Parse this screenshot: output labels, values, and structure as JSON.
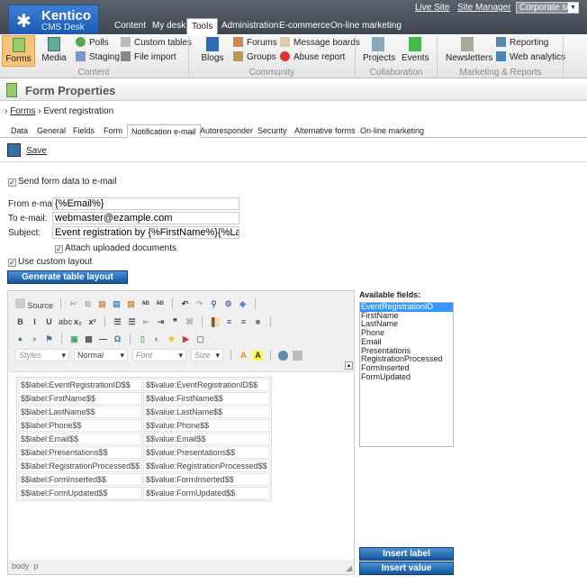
{
  "header": {
    "logo_title": "Kentico",
    "logo_sub": "CMS Desk",
    "links": [
      "Live Site",
      "Site Manager"
    ],
    "site_select": "Corporate site",
    "tabs": [
      "Content",
      "My desk",
      "Tools",
      "Administration",
      "E-commerce",
      "On-line marketing"
    ],
    "active_tab": "Tools"
  },
  "ribbon": {
    "groups": [
      "Content",
      "Community",
      "Collaboration",
      "Marketing & Reports"
    ],
    "items": {
      "forms": "Forms",
      "media": "Media",
      "polls": "Polls",
      "staging": "Staging",
      "custom_tables": "Custom tables",
      "file_import": "File import",
      "blogs": "Blogs",
      "forums": "Forums",
      "groups": "Groups",
      "message_boards": "Message boards",
      "abuse_report": "Abuse report",
      "projects": "Projects",
      "events": "Events",
      "newsletters": "Newsletters",
      "reporting": "Reporting",
      "web_analytics": "Web analytics"
    }
  },
  "page": {
    "title": "Form Properties",
    "breadcrumb": [
      "Forms",
      "Event registration"
    ],
    "tabs": [
      "Data",
      "General",
      "Fields",
      "Form",
      "Notification e-mail",
      "Autoresponder",
      "Security",
      "Alternative forms",
      "On-line marketing"
    ],
    "active_tab": "Notification e-mail",
    "save": "Save"
  },
  "form": {
    "send_label": "Send form data to e-mail",
    "send_checked": true,
    "from_label": "From e-mail:",
    "from_value": "{%Email%}",
    "to_label": "To e-mail:",
    "to_value": "webmaster@ezample.com",
    "subject_label": "Subject:",
    "subject_value": "Event registration by {%FirstName%}{%LastName%}",
    "attach_label": "Attach uploaded documents",
    "attach_checked": true,
    "custom_label": "Use custom layout",
    "custom_checked": true,
    "generate": "Generate table layout"
  },
  "editor": {
    "source": "Source",
    "styles": "Styles",
    "format": "Normal",
    "font": "Font",
    "size": "Size",
    "status": [
      "body",
      "p"
    ],
    "rows": [
      [
        "$$label:EventRegistrationID$$",
        "$$value:EventRegistrationID$$"
      ],
      [
        "$$label:FirstName$$",
        "$$value:FirstName$$"
      ],
      [
        "$$label:LastName$$",
        "$$value:LastName$$"
      ],
      [
        "$$label:Phone$$",
        "$$value:Phone$$"
      ],
      [
        "$$label:Email$$",
        "$$value:Email$$"
      ],
      [
        "$$label:Presentations$$",
        "$$value:Presentations$$"
      ],
      [
        "$$label:RegistrationProcessed$$",
        "$$value:RegistrationProcessed$$"
      ],
      [
        "$$label:FormInserted$$",
        "$$value:FormInserted$$"
      ],
      [
        "$$label:FormUpdated$$",
        "$$value:FormUpdated$$"
      ]
    ]
  },
  "fields": {
    "label": "Available fields:",
    "items": [
      "EventRegistrationID",
      "FirstName",
      "LastName",
      "Phone",
      "Email",
      "Presentations",
      "RegistrationProcessed",
      "FormInserted",
      "FormUpdated"
    ],
    "selected": "EventRegistrationID",
    "insert_label": "Insert label",
    "insert_value": "Insert value"
  }
}
